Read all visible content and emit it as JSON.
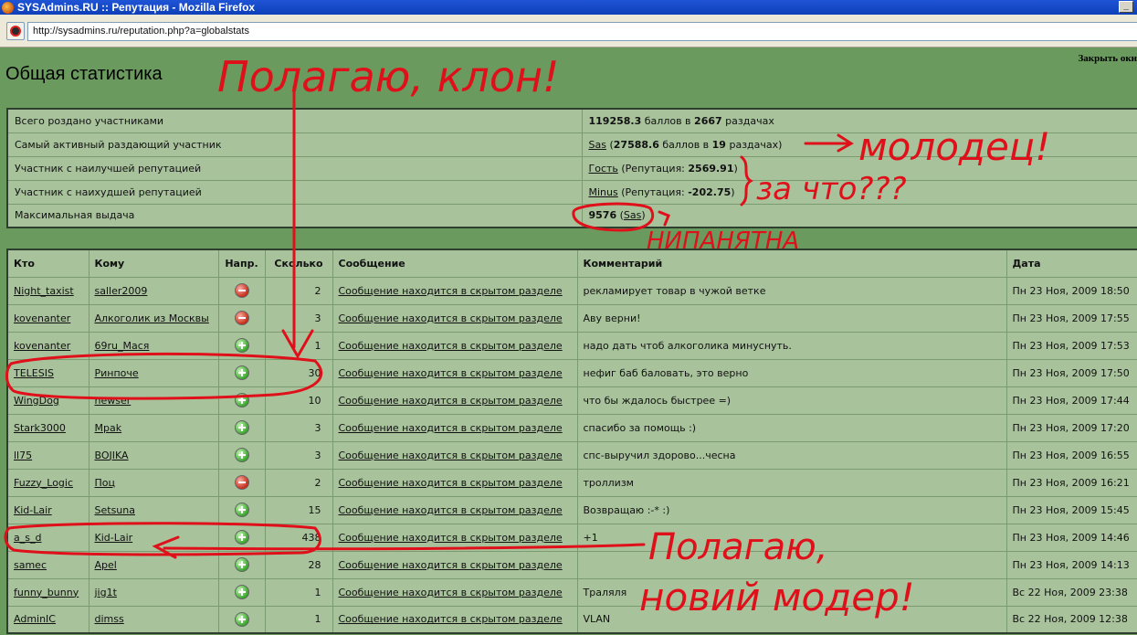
{
  "window": {
    "title": "SYSAdmins.RU :: Репутация - Mozilla Firefox"
  },
  "location": {
    "url": "http://sysadmins.ru/reputation.php?a=globalstats"
  },
  "page": {
    "title": "Общая статистика",
    "close_link": "Закрыть окн"
  },
  "stats": [
    {
      "label": "Всего роздано участниками",
      "v1": "119258.3",
      "t1": " баллов в ",
      "v2": "2667",
      "t2": " раздачах"
    },
    {
      "label": "Самый активный раздающий участник",
      "user": "Sas",
      "t0": " (",
      "v1": "27588.6",
      "t1": " баллов в ",
      "v2": "19",
      "t2": " раздачах)"
    },
    {
      "label": "Участник с наилучшей репутацией",
      "user": "Гость",
      "t0": " (Репутация: ",
      "v1": "2569.91",
      "t1": ")"
    },
    {
      "label": "Участник с наихудшей репутацией",
      "user": "Minus",
      "t0": " (Репутация: ",
      "v1": "-202.75",
      "t1": ")"
    },
    {
      "label": "Максимальная выдача",
      "v1": "9576",
      "t0": " (",
      "user": "Sas",
      "t1": ")"
    }
  ],
  "columns": [
    "Кто",
    "Кому",
    "Напр.",
    "Сколько",
    "Сообщение",
    "Комментарий",
    "Дата"
  ],
  "rows": [
    {
      "who": "Night_taxist",
      "to": "saller2009",
      "dir": "minus",
      "amount": "2",
      "msg": "Сообщение находится в скрытом разделе",
      "comment": "рекламирует товар в чужой ветке",
      "date": "Пн 23 Ноя, 2009 18:50"
    },
    {
      "who": "kovenanter",
      "to": "Алкоголик из Москвы",
      "dir": "minus",
      "amount": "3",
      "msg": "Сообщение находится в скрытом разделе",
      "comment": "Аву верни!",
      "date": "Пн 23 Ноя, 2009 17:55"
    },
    {
      "who": "kovenanter",
      "to": "69ru_Мася",
      "dir": "plus",
      "amount": "1",
      "msg": "Сообщение находится в скрытом разделе",
      "comment": "надо дать чтоб алкоголика минуснуть.",
      "date": "Пн 23 Ноя, 2009 17:53"
    },
    {
      "who": "TELESIS",
      "to": "Ринпоче",
      "dir": "plus",
      "amount": "30",
      "msg": "Сообщение находится в скрытом разделе",
      "comment": "нефиг баб баловать, это верно",
      "date": "Пн 23 Ноя, 2009 17:50"
    },
    {
      "who": "WingDog",
      "to": "newser",
      "dir": "plus",
      "amount": "10",
      "msg": "Сообщение находится в скрытом разделе",
      "comment": "что бы ждалось быстрее =)",
      "date": "Пн 23 Ноя, 2009 17:44"
    },
    {
      "who": "Stark3000",
      "to": "Mpak",
      "dir": "plus",
      "amount": "3",
      "msg": "Сообщение находится в скрытом разделе",
      "comment": "спасибо за помощь :)",
      "date": "Пн 23 Ноя, 2009 17:20"
    },
    {
      "who": "ll75",
      "to": "BOJIKA",
      "dir": "plus",
      "amount": "3",
      "msg": "Сообщение находится в скрытом разделе",
      "comment": "спс-выручил здорово...чесна",
      "date": "Пн 23 Ноя, 2009 16:55"
    },
    {
      "who": "Fuzzy_Logic",
      "to": "Поц",
      "dir": "minus",
      "amount": "2",
      "msg": "Сообщение находится в скрытом разделе",
      "comment": "троллизм",
      "date": "Пн 23 Ноя, 2009 16:21"
    },
    {
      "who": "Kid-Lair",
      "to": "Setsuna",
      "dir": "plus",
      "amount": "15",
      "msg": "Сообщение находится в скрытом разделе",
      "comment": "Возвращаю :-* :)",
      "date": "Пн 23 Ноя, 2009 15:45"
    },
    {
      "who": "a_s_d",
      "to": "Kid-Lair",
      "dir": "plus",
      "amount": "438",
      "msg": "Сообщение находится в скрытом разделе",
      "comment": "+1",
      "date": "Пн 23 Ноя, 2009 14:46"
    },
    {
      "who": "samec",
      "to": "Apel",
      "dir": "plus",
      "amount": "28",
      "msg": "Сообщение находится в скрытом разделе",
      "comment": "",
      "date": "Пн 23 Ноя, 2009 14:13"
    },
    {
      "who": "funny_bunny",
      "to": "jig1t",
      "dir": "plus",
      "amount": "1",
      "msg": "Сообщение находится в скрытом разделе",
      "comment": "Траляля",
      "date": "Вс 22 Ноя, 2009 23:38"
    },
    {
      "who": "AdminIC",
      "to": "dimss",
      "dir": "plus",
      "amount": "1",
      "msg": "Сообщение находится в скрытом разделе",
      "comment": "VLAN",
      "date": "Вс 22 Ноя, 2009 12:38"
    }
  ],
  "annotations": {
    "a1": "Полагаю, клон!",
    "a2": "молодец!",
    "a3": "за что???",
    "a4": "НИПАНЯТНА",
    "a5": "Полагаю,",
    "a6": "новий модер!"
  },
  "colors": {
    "page_bg": "#6a9a5e",
    "table_bg": "#a8c29c",
    "annotation": "#e0101a"
  }
}
